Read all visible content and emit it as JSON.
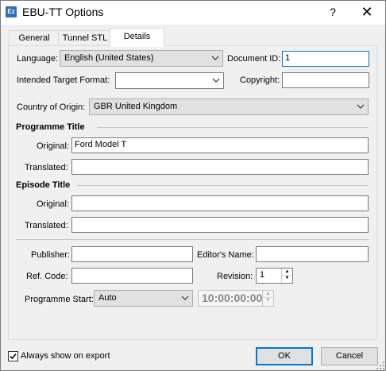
{
  "window": {
    "title": "EBU-TT Options",
    "icon_label": "Ez",
    "help_glyph": "?",
    "close_glyph": "✕"
  },
  "tabs": [
    {
      "label": "General",
      "active": false
    },
    {
      "label": "Tunnel STL",
      "active": false
    },
    {
      "label": "Details",
      "active": true
    }
  ],
  "details": {
    "language": {
      "label": "Language:",
      "value": "English (United States)"
    },
    "document_id": {
      "label": "Document ID:",
      "value": "1"
    },
    "target_format": {
      "label": "Intended Target Format:",
      "value": ""
    },
    "copyright": {
      "label": "Copyright:",
      "value": ""
    },
    "country": {
      "label": "Country of Origin:",
      "value": "GBR United Kingdom"
    },
    "programme_title": {
      "heading": "Programme Title",
      "original": {
        "label": "Original:",
        "value": "Ford Model T"
      },
      "translated": {
        "label": "Translated:",
        "value": ""
      }
    },
    "episode_title": {
      "heading": "Episode Title",
      "original": {
        "label": "Original:",
        "value": ""
      },
      "translated": {
        "label": "Translated:",
        "value": ""
      }
    },
    "publisher": {
      "label": "Publisher:",
      "value": ""
    },
    "editors_name": {
      "label": "Editor's Name:",
      "value": ""
    },
    "ref_code": {
      "label": "Ref. Code:",
      "value": ""
    },
    "revision": {
      "label": "Revision:",
      "value": "1"
    },
    "programme_start": {
      "label": "Programme Start:",
      "mode": "Auto",
      "time": "10:00:00:00"
    }
  },
  "footer": {
    "always_show_label": "Always show on export",
    "always_show_checked": true,
    "ok_label": "OK",
    "cancel_label": "Cancel"
  },
  "colors": {
    "focus_border": "#0078d7",
    "app_icon": "#2f6fb7"
  },
  "icons": [
    "app-icon",
    "help-icon",
    "close-icon",
    "chevron-down-icon",
    "spin-up-icon",
    "spin-down-icon",
    "checkmark-icon",
    "resize-grip-icon"
  ]
}
